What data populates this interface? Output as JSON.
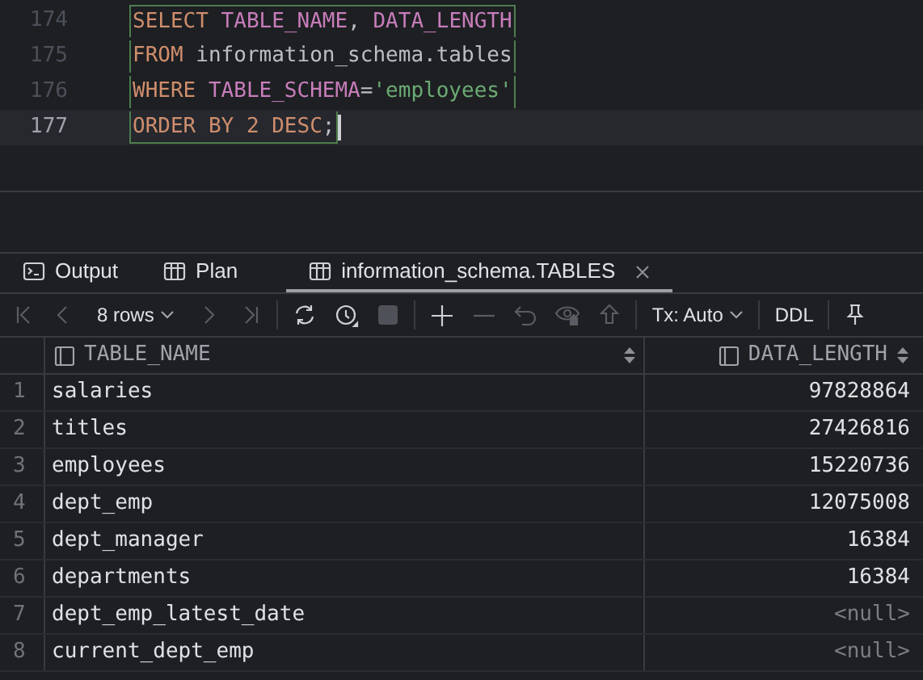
{
  "editor": {
    "lines": [
      {
        "number": "174",
        "current": false,
        "tokens": [
          {
            "kind": "keyword",
            "text": "SELECT "
          },
          {
            "kind": "identifier",
            "text": "TABLE_NAME"
          },
          {
            "kind": "plain",
            "text": ", "
          },
          {
            "kind": "identifier",
            "text": "DATA_LENGTH"
          }
        ]
      },
      {
        "number": "175",
        "current": false,
        "tokens": [
          {
            "kind": "keyword",
            "text": "FROM"
          },
          {
            "kind": "plain",
            "text": " information_schema.tables"
          }
        ]
      },
      {
        "number": "176",
        "current": false,
        "tokens": [
          {
            "kind": "keyword",
            "text": "WHERE "
          },
          {
            "kind": "identifier",
            "text": "TABLE_SCHEMA"
          },
          {
            "kind": "plain",
            "text": "="
          },
          {
            "kind": "string",
            "text": "'employees'"
          }
        ]
      },
      {
        "number": "177",
        "current": true,
        "tokens": [
          {
            "kind": "keyword",
            "text": "ORDER BY 2 DESC"
          },
          {
            "kind": "plain",
            "text": ";"
          }
        ]
      }
    ]
  },
  "tabs": [
    {
      "label": "Output",
      "kind": "console",
      "selected": false,
      "closable": false
    },
    {
      "label": "Plan",
      "kind": "table",
      "selected": false,
      "closable": false
    },
    {
      "label": "information_schema.TABLES",
      "kind": "table",
      "selected": true,
      "closable": true
    }
  ],
  "toolbar": {
    "rows": "8 rows",
    "tx": "Tx: Auto",
    "ddl": "DDL"
  },
  "table": {
    "columns": [
      {
        "label": "TABLE_NAME"
      },
      {
        "label": "DATA_LENGTH"
      }
    ],
    "rows": [
      {
        "number": "1",
        "cells": [
          {
            "text": "salaries",
            "null": false
          },
          {
            "text": "97828864",
            "null": false
          }
        ]
      },
      {
        "number": "2",
        "cells": [
          {
            "text": "titles",
            "null": false
          },
          {
            "text": "27426816",
            "null": false
          }
        ]
      },
      {
        "number": "3",
        "cells": [
          {
            "text": "employees",
            "null": false
          },
          {
            "text": "15220736",
            "null": false
          }
        ]
      },
      {
        "number": "4",
        "cells": [
          {
            "text": "dept_emp",
            "null": false
          },
          {
            "text": "12075008",
            "null": false
          }
        ]
      },
      {
        "number": "5",
        "cells": [
          {
            "text": "dept_manager",
            "null": false
          },
          {
            "text": "16384",
            "null": false
          }
        ]
      },
      {
        "number": "6",
        "cells": [
          {
            "text": "departments",
            "null": false
          },
          {
            "text": "16384",
            "null": false
          }
        ]
      },
      {
        "number": "7",
        "cells": [
          {
            "text": "dept_emp_latest_date",
            "null": false
          },
          {
            "text": "<null>",
            "null": true
          }
        ]
      },
      {
        "number": "8",
        "cells": [
          {
            "text": "current_dept_emp",
            "null": false
          },
          {
            "text": "<null>",
            "null": true
          }
        ]
      }
    ]
  }
}
